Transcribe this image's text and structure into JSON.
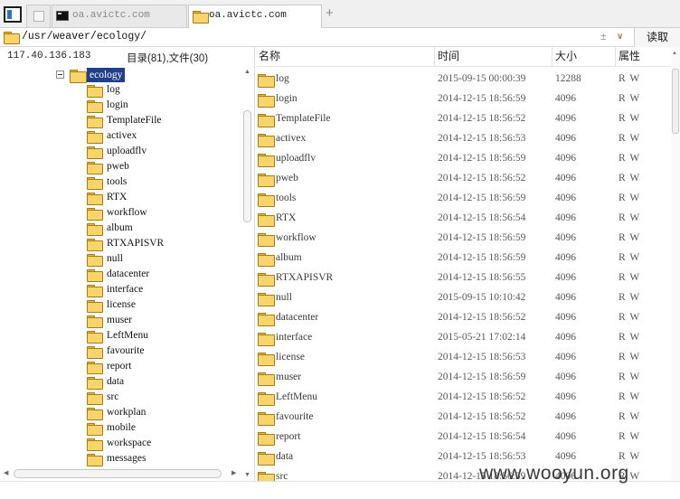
{
  "tabs": [
    {
      "label": ""
    },
    {
      "label": "oa.avictc.com",
      "icon": "terminal-icon"
    },
    {
      "label": "oa.avictc.com",
      "icon": "folder-icon",
      "active": true
    }
  ],
  "add_tab": "+",
  "address": {
    "path": "/usr/weaver/ecology/",
    "sort_symbol": "±",
    "dropdown_symbol": "∨",
    "read_button": "读取"
  },
  "left_panel": {
    "host": "117.40.136.183",
    "counts": "目录(81),文件(30)",
    "root": "ecology",
    "items": [
      "log",
      "login",
      "TemplateFile",
      "activex",
      "uploadflv",
      "pweb",
      "tools",
      "RTX",
      "workflow",
      "album",
      "RTXAPISVR",
      "null",
      "datacenter",
      "interface",
      "license",
      "muser",
      "LeftMenu",
      "favourite",
      "report",
      "data",
      "src",
      "workplan",
      "mobile",
      "workspace",
      "messages"
    ]
  },
  "file_list": {
    "columns": {
      "name": "名称",
      "time": "时间",
      "size": "大小",
      "attr": "属性"
    },
    "rows": [
      {
        "name": "log",
        "time": "2015-09-15 00:00:39",
        "size": "12288",
        "attr": "R W"
      },
      {
        "name": "login",
        "time": "2014-12-15 18:56:59",
        "size": "4096",
        "attr": "R W"
      },
      {
        "name": "TemplateFile",
        "time": "2014-12-15 18:56:52",
        "size": "4096",
        "attr": "R W"
      },
      {
        "name": "activex",
        "time": "2014-12-15 18:56:53",
        "size": "4096",
        "attr": "R W"
      },
      {
        "name": "uploadflv",
        "time": "2014-12-15 18:56:59",
        "size": "4096",
        "attr": "R W"
      },
      {
        "name": "pweb",
        "time": "2014-12-15 18:56:52",
        "size": "4096",
        "attr": "R W"
      },
      {
        "name": "tools",
        "time": "2014-12-15 18:56:59",
        "size": "4096",
        "attr": "R W"
      },
      {
        "name": "RTX",
        "time": "2014-12-15 18:56:54",
        "size": "4096",
        "attr": "R W"
      },
      {
        "name": "workflow",
        "time": "2014-12-15 18:56:59",
        "size": "4096",
        "attr": "R W"
      },
      {
        "name": "album",
        "time": "2014-12-15 18:56:59",
        "size": "4096",
        "attr": "R W"
      },
      {
        "name": "RTXAPISVR",
        "time": "2014-12-15 18:56:55",
        "size": "4096",
        "attr": "R W"
      },
      {
        "name": "null",
        "time": "2015-09-15 10:10:42",
        "size": "4096",
        "attr": "R W"
      },
      {
        "name": "datacenter",
        "time": "2014-12-15 18:56:52",
        "size": "4096",
        "attr": "R W"
      },
      {
        "name": "interface",
        "time": "2015-05-21 17:02:14",
        "size": "4096",
        "attr": "R W"
      },
      {
        "name": "license",
        "time": "2014-12-15 18:56:53",
        "size": "4096",
        "attr": "R W"
      },
      {
        "name": "muser",
        "time": "2014-12-15 18:56:59",
        "size": "4096",
        "attr": "R W"
      },
      {
        "name": "LeftMenu",
        "time": "2014-12-15 18:56:52",
        "size": "4096",
        "attr": "R W"
      },
      {
        "name": "favourite",
        "time": "2014-12-15 18:56:52",
        "size": "4096",
        "attr": "R W"
      },
      {
        "name": "report",
        "time": "2014-12-15 18:56:54",
        "size": "4096",
        "attr": "R W"
      },
      {
        "name": "data",
        "time": "2014-12-15 18:56:53",
        "size": "4096",
        "attr": "R W"
      },
      {
        "name": "src",
        "time": "2014-12-15 18:56:59",
        "size": "4096",
        "attr": "R W"
      }
    ]
  },
  "watermark": "www.wooyun.org",
  "colors": {
    "selection": "#1f3f8c",
    "folder": "#f7d56a",
    "folder_border": "#a97c12"
  }
}
